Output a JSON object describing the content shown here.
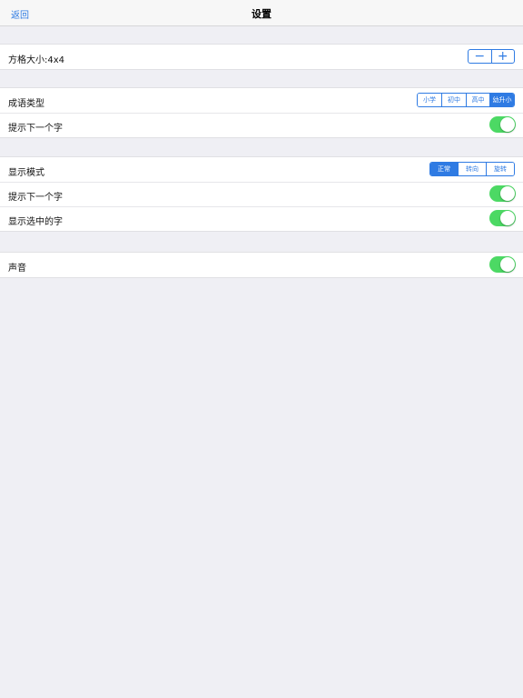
{
  "navbar": {
    "back_label": "返回",
    "title": "设置"
  },
  "grid": {
    "label": "方格大小:4x4",
    "minus": "−",
    "plus": "+"
  },
  "idiom": {
    "type_label": "成语类型",
    "types": [
      "小学",
      "初中",
      "高中",
      "幼升小"
    ],
    "selected": "幼升小",
    "hint_label": "提示下一个字",
    "hint_on": true
  },
  "display": {
    "mode_label": "显示模式",
    "modes": [
      "正常",
      "转向",
      "旋转"
    ],
    "selected": "正常",
    "hint_label": "提示下一个字",
    "hint_on": true,
    "show_selected_label": "显示选中的字",
    "show_selected_on": true
  },
  "sound": {
    "label": "声音",
    "on": true
  },
  "colors": {
    "accent": "#2f7be3",
    "toggle_on": "#4cd964",
    "background": "#efeff4"
  }
}
